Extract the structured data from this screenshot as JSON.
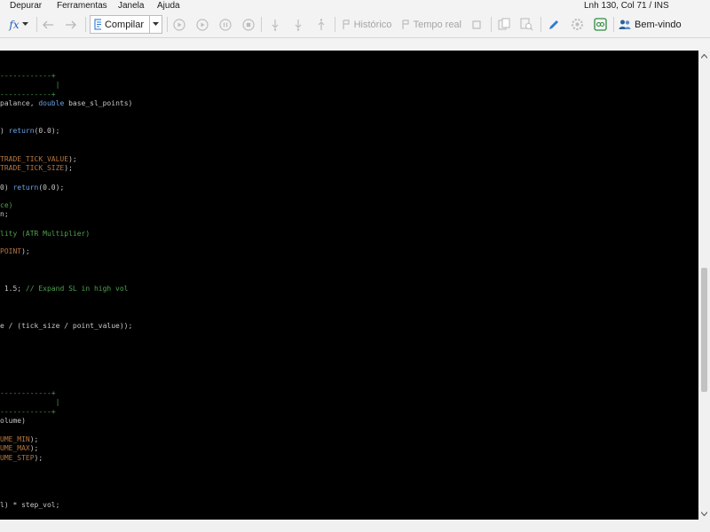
{
  "menu": {
    "items": [
      "Depurar",
      "Ferramentas",
      "Janela",
      "Ajuda"
    ]
  },
  "status": {
    "text": "Lnh 130, Col 71  /  INS"
  },
  "toolbar": {
    "compile_label": "Compilar",
    "history_label": "Histórico",
    "realtime_label": "Tempo real",
    "welcome_label": "Bem-vindo",
    "fx_label": "fx"
  },
  "editor": {
    "lines": [
      {
        "segs": [
          {
            "t": "------------+",
            "c": "green"
          }
        ]
      },
      {
        "segs": [
          {
            "t": "             |",
            "c": "green"
          }
        ]
      },
      {
        "segs": [
          {
            "t": "------------+",
            "c": "green"
          }
        ]
      },
      {
        "segs": [
          {
            "t": "palance, ",
            "c": "def"
          },
          {
            "t": "double",
            "c": "blue"
          },
          {
            "t": " base_sl_points)",
            "c": "def"
          }
        ]
      },
      {
        "segs": [
          {
            "t": ") ",
            "c": "def"
          },
          {
            "t": "return",
            "c": "blue"
          },
          {
            "t": "(0.0);",
            "c": "def"
          }
        ]
      },
      {
        "segs": [
          {
            "t": "TRADE_TICK_VALUE",
            "c": "orange"
          },
          {
            "t": ");",
            "c": "def"
          }
        ]
      },
      {
        "segs": [
          {
            "t": "TRADE_TICK_SIZE",
            "c": "orange"
          },
          {
            "t": ");",
            "c": "def"
          }
        ]
      },
      {
        "segs": [
          {
            "t": "0) ",
            "c": "def"
          },
          {
            "t": "return",
            "c": "blue"
          },
          {
            "t": "(0.0);",
            "c": "def"
          }
        ]
      },
      {
        "segs": [
          {
            "t": "ce)",
            "c": "green"
          }
        ]
      },
      {
        "segs": [
          {
            "t": "n;",
            "c": "def"
          }
        ]
      },
      {
        "segs": [
          {
            "t": "lity (ATR Multiplier)",
            "c": "green"
          }
        ]
      },
      {
        "segs": [
          {
            "t": "POINT",
            "c": "orange"
          },
          {
            "t": ");",
            "c": "def"
          }
        ]
      },
      {
        "segs": [
          {
            "t": " 1.5; ",
            "c": "def"
          },
          {
            "t": "// Expand SL in high vol",
            "c": "green"
          }
        ]
      },
      {
        "segs": [
          {
            "t": "e / (tick_size / point_value));",
            "c": "def"
          }
        ]
      },
      {
        "segs": [
          {
            "t": "------------+",
            "c": "green"
          }
        ]
      },
      {
        "segs": [
          {
            "t": "             |",
            "c": "green"
          }
        ]
      },
      {
        "segs": [
          {
            "t": "------------+",
            "c": "green"
          }
        ]
      },
      {
        "segs": [
          {
            "t": "olume)",
            "c": "def"
          }
        ]
      },
      {
        "segs": [
          {
            "t": "UME_MIN",
            "c": "orange"
          },
          {
            "t": ");",
            "c": "def"
          }
        ]
      },
      {
        "segs": [
          {
            "t": "UME_MAX",
            "c": "orange"
          },
          {
            "t": ");",
            "c": "def"
          }
        ]
      },
      {
        "segs": [
          {
            "t": "UME_STEP",
            "c": "orange"
          },
          {
            "t": ");",
            "c": "def"
          }
        ]
      },
      {
        "segs": [
          {
            "t": "l) * step_vol;",
            "c": "def"
          }
        ]
      }
    ]
  }
}
